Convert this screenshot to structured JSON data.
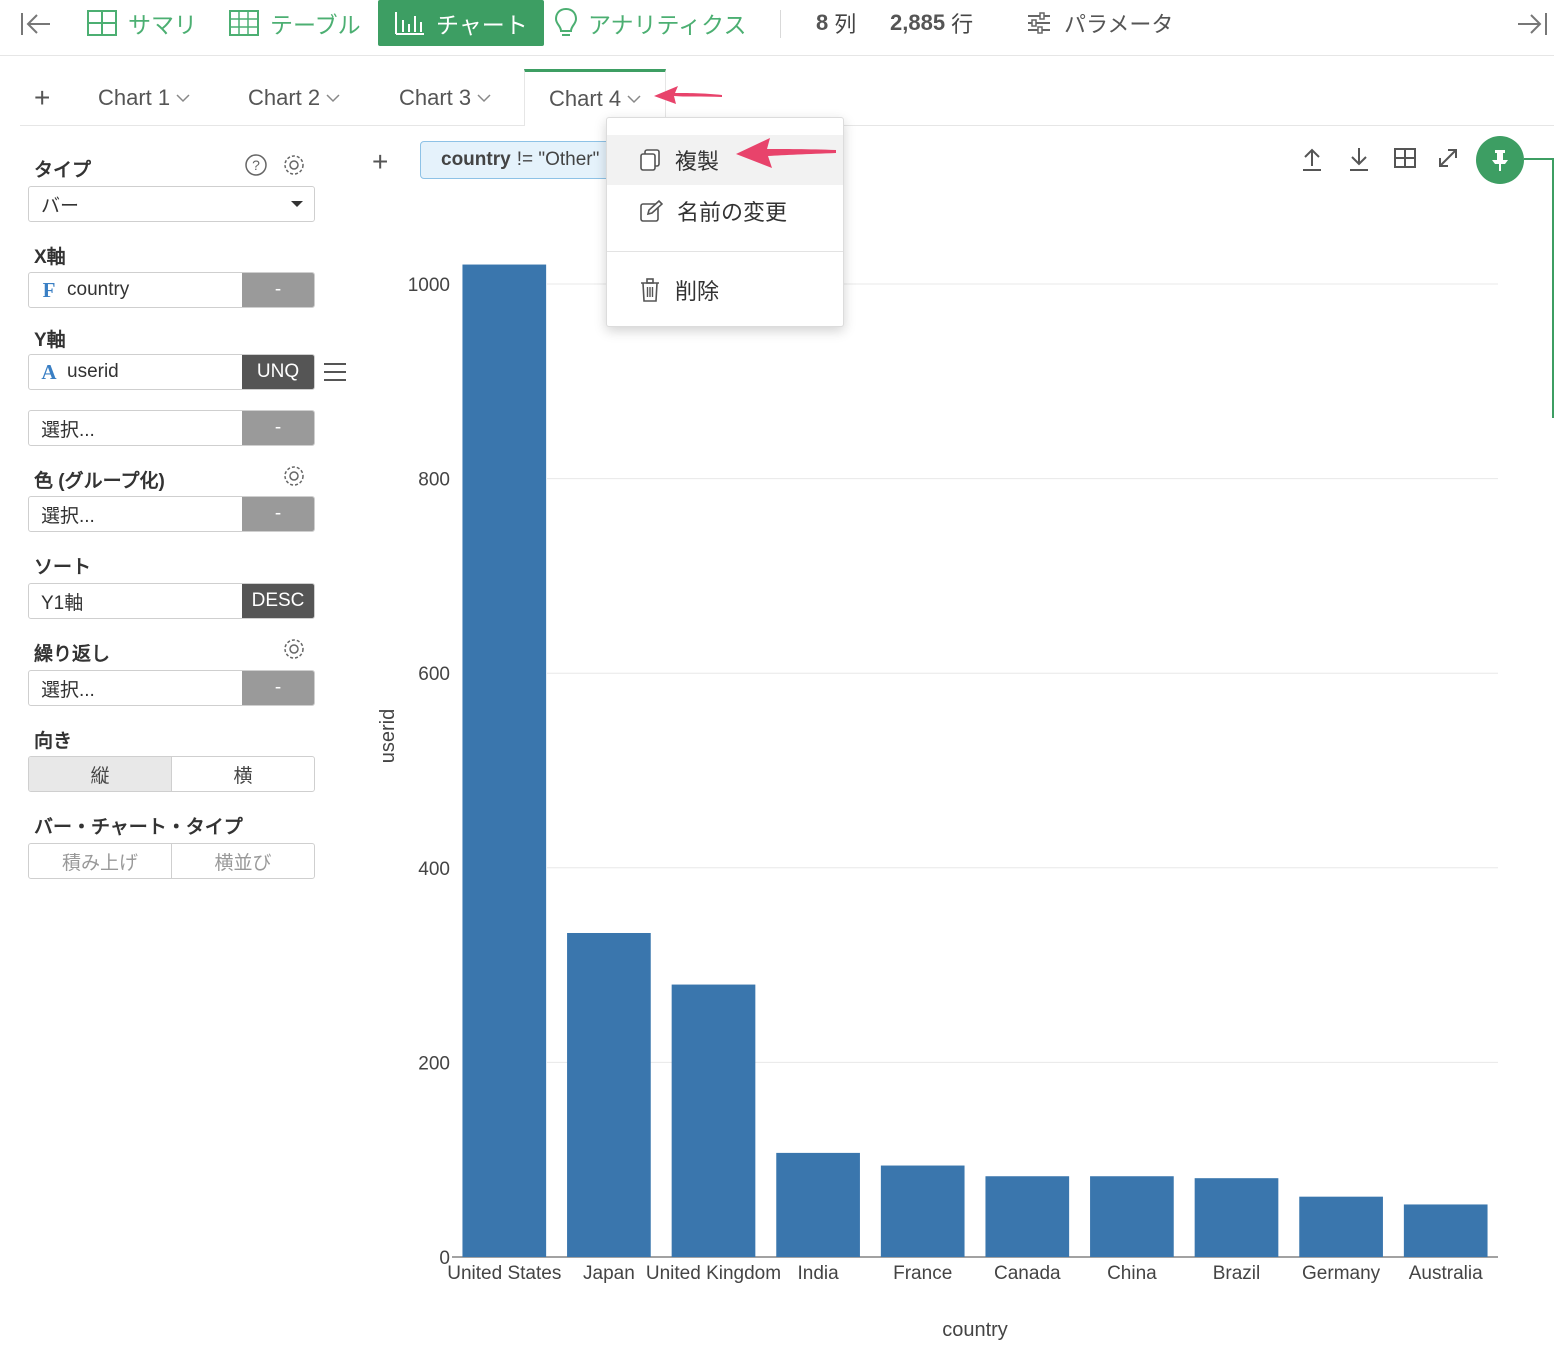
{
  "toolbar": {
    "summary": "サマリ",
    "table": "テーブル",
    "chart": "チャート",
    "analytics": "アナリティクス",
    "columns_count": "8",
    "columns_unit": "列",
    "rows_count": "2,885",
    "rows_unit": "行",
    "parameters": "パラメータ",
    "accent_color": "#3d9e63"
  },
  "tabs": [
    {
      "label": "Chart 1"
    },
    {
      "label": "Chart 2"
    },
    {
      "label": "Chart 3"
    },
    {
      "label": "Chart 4",
      "active": true
    }
  ],
  "panel": {
    "type_label": "タイプ",
    "type_value": "バー",
    "x_axis_label": "X軸",
    "x_field_type": "F",
    "x_field": "country",
    "x_agg": "-",
    "y_axis_label": "Y軸",
    "y_field_type": "A",
    "y_field": "userid",
    "y_agg": "UNQ",
    "y2_placeholder": "選択...",
    "y2_agg": "-",
    "color_label": "色 (グループ化)",
    "color_placeholder": "選択...",
    "color_agg": "-",
    "sort_label": "ソート",
    "sort_value": "Y1軸",
    "sort_order": "DESC",
    "repeat_label": "繰り返し",
    "repeat_placeholder": "選択...",
    "repeat_agg": "-",
    "orientation_label": "向き",
    "orientation_vertical": "縦",
    "orientation_horizontal": "横",
    "bar_type_label": "バー・チャート・タイプ",
    "bar_type_stacked": "積み上げ",
    "bar_type_side": "横並び"
  },
  "filter": {
    "field": "country",
    "expression": "!= \"Other\""
  },
  "menu": {
    "duplicate": "複製",
    "rename": "名前の変更",
    "delete": "削除"
  },
  "chart_data": {
    "type": "bar",
    "categories": [
      "United States",
      "Japan",
      "United Kingdom",
      "India",
      "France",
      "Canada",
      "China",
      "Brazil",
      "Germany",
      "Australia"
    ],
    "values": [
      1020,
      333,
      280,
      107,
      94,
      83,
      83,
      81,
      62,
      54
    ],
    "xlabel": "country",
    "ylabel": "userid",
    "ylim": [
      0,
      1000
    ],
    "yticks": [
      0,
      200,
      400,
      600,
      800,
      1000
    ],
    "bar_color": "#3a76ad",
    "grid": true
  }
}
